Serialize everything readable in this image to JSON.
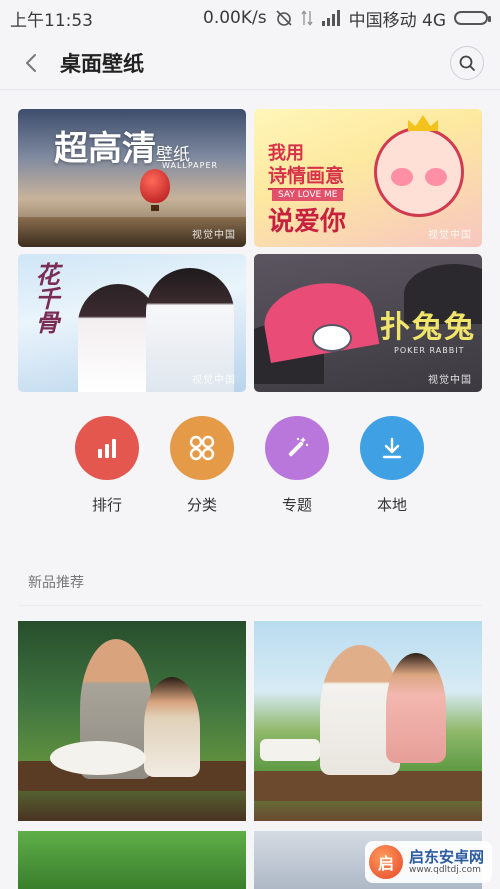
{
  "status_bar": {
    "time": "上午11:53",
    "net_speed": "0.00K/s",
    "carrier": "中国移动 4G"
  },
  "header": {
    "title": "桌面壁纸"
  },
  "banners": [
    {
      "title": "超高清",
      "title_small": "壁纸",
      "subtitle": "WALLPAPER",
      "watermark": "视觉中国"
    },
    {
      "line1": "我用",
      "line2": "诗情画意",
      "tag": "SAY LOVE ME",
      "line3": "说爱你",
      "watermark": "视觉中国"
    },
    {
      "title": "花千骨",
      "watermark": "视觉中国"
    },
    {
      "title": "扑兔兔",
      "subtitle": "POKER RABBIT",
      "watermark": "视觉中国"
    }
  ],
  "categories": [
    {
      "label": "排行",
      "color": "#e4574f",
      "icon": "bar-chart-icon"
    },
    {
      "label": "分类",
      "color": "#e59a48",
      "icon": "grid-circles-icon"
    },
    {
      "label": "专题",
      "color": "#b977dc",
      "icon": "magic-wand-icon"
    },
    {
      "label": "本地",
      "color": "#3fa0e4",
      "icon": "download-icon"
    }
  ],
  "section": {
    "title": "新品推荐"
  },
  "site_watermark": {
    "name": "启东安卓网",
    "url": "www.qdltdj.com"
  }
}
